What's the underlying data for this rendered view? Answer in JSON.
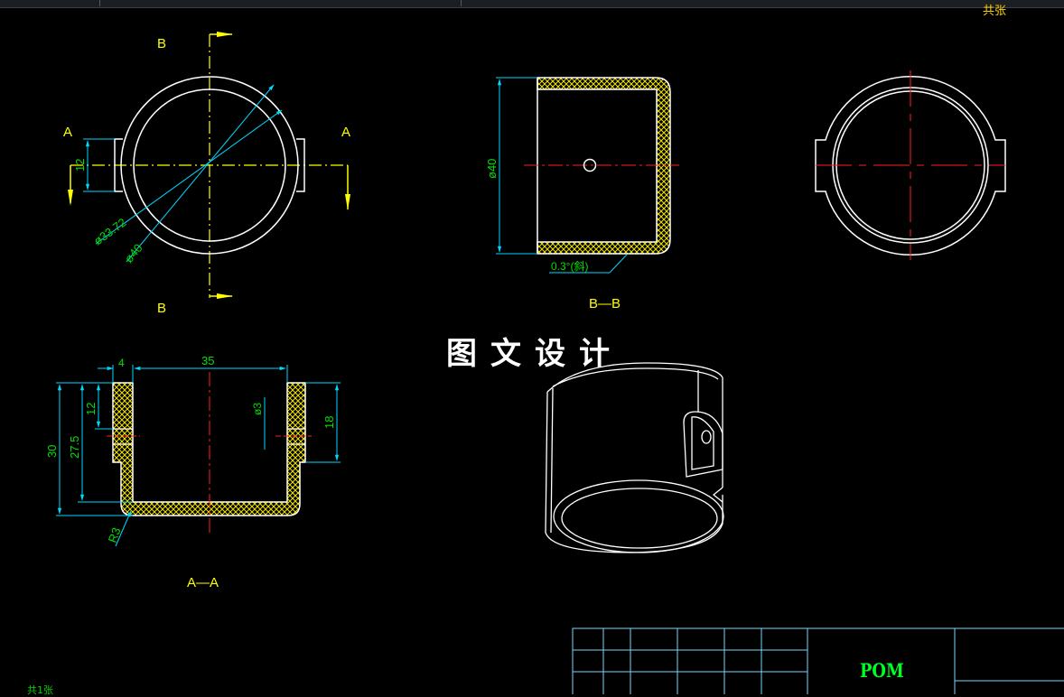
{
  "title_watermark": "图文设计",
  "top_right_label": "共张",
  "bottom_left_label": "共1张",
  "material": "POM",
  "section_labels": {
    "top_view_b_top": "B",
    "top_view_b_bottom": "B",
    "top_view_a_left": "A",
    "top_view_a_right": "A",
    "section_bb": "B—B",
    "section_aa": "A—A"
  },
  "dimensions": {
    "tab_width": "12",
    "inner_dia": "ø33.72",
    "outer_dia": "ø40",
    "bb_height": "ø40",
    "bb_finish": "0.3°(斜)",
    "aa_wall": "4",
    "aa_width": "35",
    "aa_total_height": "30",
    "aa_inner_height": "27.5",
    "aa_top_step": "12",
    "aa_hole": "ø3",
    "aa_right_step": "18",
    "aa_fillet": "R3"
  },
  "colors": {
    "outline": "#ffffff",
    "centerline": "#ff2020",
    "axis": "#ffff00",
    "dimension": "#00d8ff",
    "dim_text": "#00e000",
    "hatch": "#f2e600",
    "table": "#7ad8ff"
  }
}
